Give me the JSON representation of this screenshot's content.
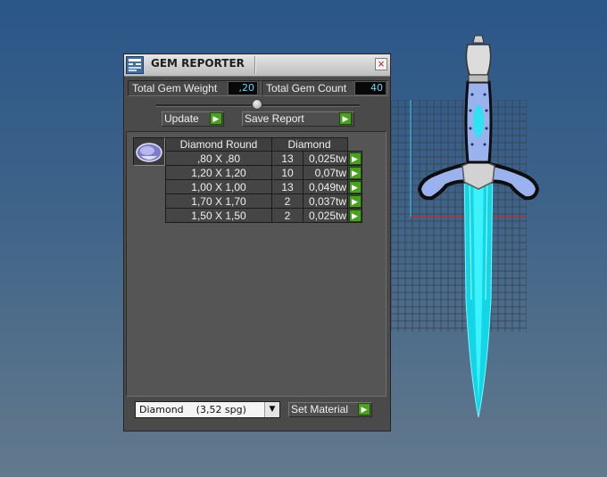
{
  "panel": {
    "title": "GEM REPORTER",
    "close_symbol": "×",
    "total_weight_label": "Total Gem Weight",
    "total_weight_value": ",20",
    "total_count_label": "Total Gem Count",
    "total_count_value": "40",
    "update_label": "Update",
    "save_report_label": "Save Report",
    "arrow_symbol": "▶",
    "table": {
      "headers": [
        "Diamond Round",
        "Diamond"
      ],
      "rows": [
        {
          "size": ",80 X ,80",
          "count": "13",
          "weight": "0,025tw"
        },
        {
          "size": "1,20 X 1,20",
          "count": "10",
          "weight": "0,07tw"
        },
        {
          "size": "1,00 X 1,00",
          "count": "13",
          "weight": "0,049tw"
        },
        {
          "size": "1,70 X 1,70",
          "count": "2",
          "weight": "0,037tw"
        },
        {
          "size": "1,50 X 1,50",
          "count": "2",
          "weight": "0,025tw"
        }
      ]
    },
    "material_select": "Diamond    (3,52 spg)",
    "dropdown_symbol": "▼",
    "set_material_label": "Set Material"
  },
  "colors": {
    "value_text": "#5fd8ff",
    "accent_green": "#49a21e",
    "blade_cyan": "#1ee6f2",
    "gem_blue": "#9ab2ee",
    "background_top": "#2a5688"
  },
  "icons": [
    "app-icon",
    "close-icon",
    "arrow-right-icon",
    "gem-thumbnail",
    "dropdown-arrow-icon"
  ]
}
